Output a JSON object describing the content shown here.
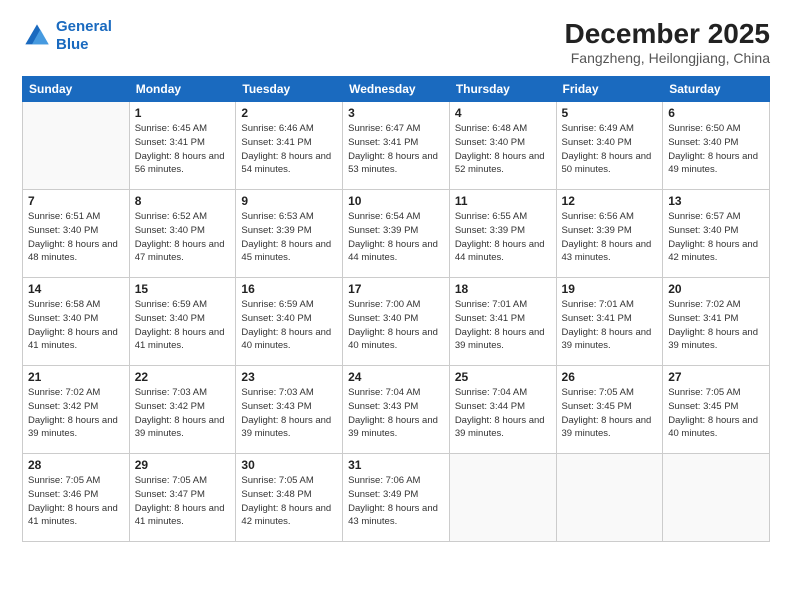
{
  "logo": {
    "line1": "General",
    "line2": "Blue"
  },
  "title": {
    "month_year": "December 2025",
    "location": "Fangzheng, Heilongjiang, China"
  },
  "days_of_week": [
    "Sunday",
    "Monday",
    "Tuesday",
    "Wednesday",
    "Thursday",
    "Friday",
    "Saturday"
  ],
  "weeks": [
    [
      {
        "day": "",
        "sunrise": "",
        "sunset": "",
        "daylight": ""
      },
      {
        "day": "1",
        "sunrise": "Sunrise: 6:45 AM",
        "sunset": "Sunset: 3:41 PM",
        "daylight": "Daylight: 8 hours and 56 minutes."
      },
      {
        "day": "2",
        "sunrise": "Sunrise: 6:46 AM",
        "sunset": "Sunset: 3:41 PM",
        "daylight": "Daylight: 8 hours and 54 minutes."
      },
      {
        "day": "3",
        "sunrise": "Sunrise: 6:47 AM",
        "sunset": "Sunset: 3:41 PM",
        "daylight": "Daylight: 8 hours and 53 minutes."
      },
      {
        "day": "4",
        "sunrise": "Sunrise: 6:48 AM",
        "sunset": "Sunset: 3:40 PM",
        "daylight": "Daylight: 8 hours and 52 minutes."
      },
      {
        "day": "5",
        "sunrise": "Sunrise: 6:49 AM",
        "sunset": "Sunset: 3:40 PM",
        "daylight": "Daylight: 8 hours and 50 minutes."
      },
      {
        "day": "6",
        "sunrise": "Sunrise: 6:50 AM",
        "sunset": "Sunset: 3:40 PM",
        "daylight": "Daylight: 8 hours and 49 minutes."
      }
    ],
    [
      {
        "day": "7",
        "sunrise": "Sunrise: 6:51 AM",
        "sunset": "Sunset: 3:40 PM",
        "daylight": "Daylight: 8 hours and 48 minutes."
      },
      {
        "day": "8",
        "sunrise": "Sunrise: 6:52 AM",
        "sunset": "Sunset: 3:40 PM",
        "daylight": "Daylight: 8 hours and 47 minutes."
      },
      {
        "day": "9",
        "sunrise": "Sunrise: 6:53 AM",
        "sunset": "Sunset: 3:39 PM",
        "daylight": "Daylight: 8 hours and 45 minutes."
      },
      {
        "day": "10",
        "sunrise": "Sunrise: 6:54 AM",
        "sunset": "Sunset: 3:39 PM",
        "daylight": "Daylight: 8 hours and 44 minutes."
      },
      {
        "day": "11",
        "sunrise": "Sunrise: 6:55 AM",
        "sunset": "Sunset: 3:39 PM",
        "daylight": "Daylight: 8 hours and 44 minutes."
      },
      {
        "day": "12",
        "sunrise": "Sunrise: 6:56 AM",
        "sunset": "Sunset: 3:39 PM",
        "daylight": "Daylight: 8 hours and 43 minutes."
      },
      {
        "day": "13",
        "sunrise": "Sunrise: 6:57 AM",
        "sunset": "Sunset: 3:40 PM",
        "daylight": "Daylight: 8 hours and 42 minutes."
      }
    ],
    [
      {
        "day": "14",
        "sunrise": "Sunrise: 6:58 AM",
        "sunset": "Sunset: 3:40 PM",
        "daylight": "Daylight: 8 hours and 41 minutes."
      },
      {
        "day": "15",
        "sunrise": "Sunrise: 6:59 AM",
        "sunset": "Sunset: 3:40 PM",
        "daylight": "Daylight: 8 hours and 41 minutes."
      },
      {
        "day": "16",
        "sunrise": "Sunrise: 6:59 AM",
        "sunset": "Sunset: 3:40 PM",
        "daylight": "Daylight: 8 hours and 40 minutes."
      },
      {
        "day": "17",
        "sunrise": "Sunrise: 7:00 AM",
        "sunset": "Sunset: 3:40 PM",
        "daylight": "Daylight: 8 hours and 40 minutes."
      },
      {
        "day": "18",
        "sunrise": "Sunrise: 7:01 AM",
        "sunset": "Sunset: 3:41 PM",
        "daylight": "Daylight: 8 hours and 39 minutes."
      },
      {
        "day": "19",
        "sunrise": "Sunrise: 7:01 AM",
        "sunset": "Sunset: 3:41 PM",
        "daylight": "Daylight: 8 hours and 39 minutes."
      },
      {
        "day": "20",
        "sunrise": "Sunrise: 7:02 AM",
        "sunset": "Sunset: 3:41 PM",
        "daylight": "Daylight: 8 hours and 39 minutes."
      }
    ],
    [
      {
        "day": "21",
        "sunrise": "Sunrise: 7:02 AM",
        "sunset": "Sunset: 3:42 PM",
        "daylight": "Daylight: 8 hours and 39 minutes."
      },
      {
        "day": "22",
        "sunrise": "Sunrise: 7:03 AM",
        "sunset": "Sunset: 3:42 PM",
        "daylight": "Daylight: 8 hours and 39 minutes."
      },
      {
        "day": "23",
        "sunrise": "Sunrise: 7:03 AM",
        "sunset": "Sunset: 3:43 PM",
        "daylight": "Daylight: 8 hours and 39 minutes."
      },
      {
        "day": "24",
        "sunrise": "Sunrise: 7:04 AM",
        "sunset": "Sunset: 3:43 PM",
        "daylight": "Daylight: 8 hours and 39 minutes."
      },
      {
        "day": "25",
        "sunrise": "Sunrise: 7:04 AM",
        "sunset": "Sunset: 3:44 PM",
        "daylight": "Daylight: 8 hours and 39 minutes."
      },
      {
        "day": "26",
        "sunrise": "Sunrise: 7:05 AM",
        "sunset": "Sunset: 3:45 PM",
        "daylight": "Daylight: 8 hours and 39 minutes."
      },
      {
        "day": "27",
        "sunrise": "Sunrise: 7:05 AM",
        "sunset": "Sunset: 3:45 PM",
        "daylight": "Daylight: 8 hours and 40 minutes."
      }
    ],
    [
      {
        "day": "28",
        "sunrise": "Sunrise: 7:05 AM",
        "sunset": "Sunset: 3:46 PM",
        "daylight": "Daylight: 8 hours and 41 minutes."
      },
      {
        "day": "29",
        "sunrise": "Sunrise: 7:05 AM",
        "sunset": "Sunset: 3:47 PM",
        "daylight": "Daylight: 8 hours and 41 minutes."
      },
      {
        "day": "30",
        "sunrise": "Sunrise: 7:05 AM",
        "sunset": "Sunset: 3:48 PM",
        "daylight": "Daylight: 8 hours and 42 minutes."
      },
      {
        "day": "31",
        "sunrise": "Sunrise: 7:06 AM",
        "sunset": "Sunset: 3:49 PM",
        "daylight": "Daylight: 8 hours and 43 minutes."
      },
      {
        "day": "",
        "sunrise": "",
        "sunset": "",
        "daylight": ""
      },
      {
        "day": "",
        "sunrise": "",
        "sunset": "",
        "daylight": ""
      },
      {
        "day": "",
        "sunrise": "",
        "sunset": "",
        "daylight": ""
      }
    ]
  ]
}
